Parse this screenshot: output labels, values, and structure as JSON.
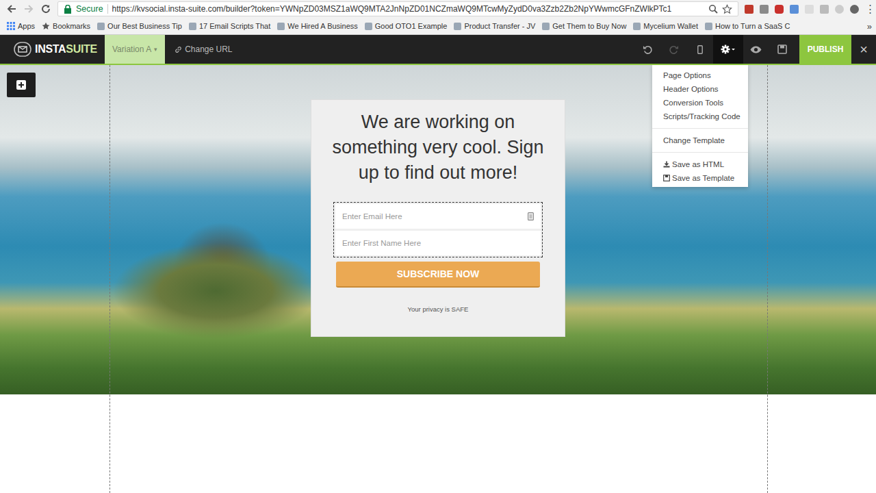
{
  "browser": {
    "secure_label": "Secure",
    "url": "https://kvsocial.insta-suite.com/builder?token=YWNpZD03MSZ1aWQ9MTA2JnNpZD01NCZmaWQ9MTcwMyZydD0va3Zzb2Zb2NpYWwmcGFnZWlkPTc1",
    "forward_disabled": true,
    "menu_glyph": "⋮"
  },
  "bookmarks": {
    "items": [
      "Apps",
      "Bookmarks",
      "Our Best Business Tip",
      "17 Email Scripts That",
      "We Hired A Business",
      "Good OTO1 Example",
      "Product Transfer - JV",
      "Get Them to Buy Now",
      "Mycelium Wallet",
      "How to Turn a SaaS C"
    ],
    "more": "»"
  },
  "header": {
    "logo": {
      "prefix": "INSTA",
      "suffix": "SUITE"
    },
    "variation": {
      "label": "Variation A",
      "caret": "▾"
    },
    "change_url": "Change URL",
    "toolbar": [
      {
        "kind": "undo",
        "disabled": false,
        "selected": false
      },
      {
        "kind": "redo",
        "disabled": true,
        "selected": false
      },
      {
        "kind": "mobile",
        "disabled": false,
        "selected": false
      },
      {
        "kind": "settings",
        "disabled": false,
        "selected": true
      },
      {
        "kind": "preview",
        "disabled": false,
        "selected": false
      },
      {
        "kind": "save",
        "disabled": false,
        "selected": false
      }
    ],
    "publish": "PUBLISH",
    "close": "×"
  },
  "settings_menu": {
    "groups": [
      [
        {
          "label": "Page Options",
          "kind": "plain"
        },
        {
          "label": "Header Options",
          "kind": "plain"
        },
        {
          "label": "Conversion Tools",
          "kind": "plain"
        },
        {
          "label": "Scripts/Tracking Code",
          "kind": "plain"
        }
      ],
      [
        {
          "label": "Change Template",
          "kind": "plain"
        }
      ],
      [
        {
          "label": "Save as HTML",
          "kind": "download"
        },
        {
          "label": "Save as Template",
          "kind": "save"
        }
      ]
    ]
  },
  "card": {
    "heading": "We are working on something very cool. Sign up to find out more!",
    "fields": [
      {
        "placeholder": "Enter Email Here",
        "has_icon": true
      },
      {
        "placeholder": "Enter First Name Here",
        "has_icon": false
      }
    ],
    "button": "SUBSCRIBE NOW",
    "privacy": "Your privacy is SAFE"
  }
}
